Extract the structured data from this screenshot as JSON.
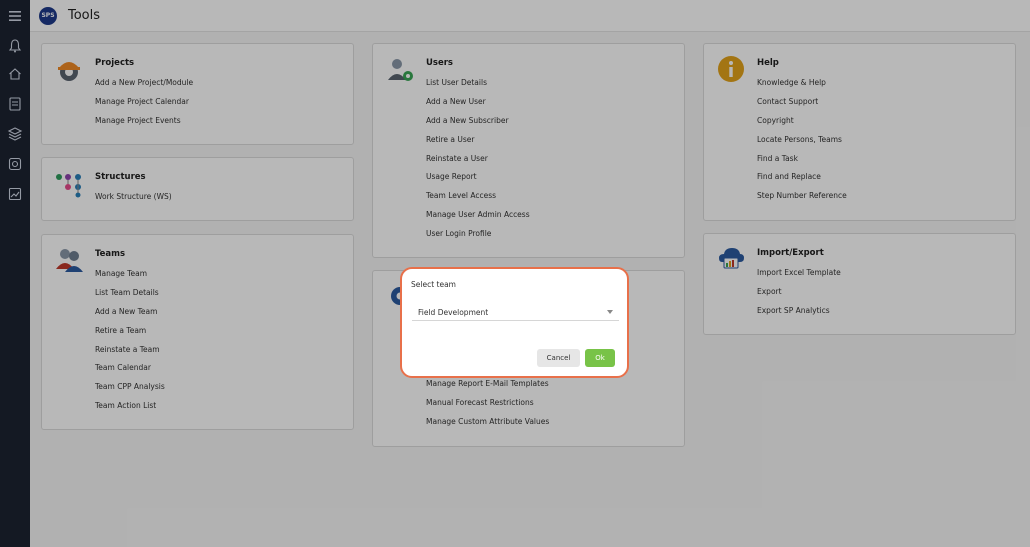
{
  "header": {
    "logo_text": "SPS",
    "title": "Tools"
  },
  "rail": {
    "icons": [
      "menu-icon",
      "bell-icon",
      "home-icon",
      "document-icon",
      "layers-icon",
      "box-icon",
      "chart-icon"
    ]
  },
  "projects": {
    "title": "Projects",
    "items": [
      "Add a New Project/Module",
      "Manage Project Calendar",
      "Manage Project Events"
    ]
  },
  "structures": {
    "title": "Structures",
    "items": [
      "Work Structure (WS)"
    ]
  },
  "teams": {
    "title": "Teams",
    "items": [
      "Manage Team",
      "List Team Details",
      "Add a New Team",
      "Retire a Team",
      "Reinstate a Team",
      "Team Calendar",
      "Team CPP Analysis",
      "Team Action List"
    ]
  },
  "users": {
    "title": "Users",
    "items": [
      "List User Details",
      "Add a New User",
      "Add a New Subscriber",
      "Retire a User",
      "Reinstate a User",
      "Usage Report",
      "Team Level Access",
      "Manage User Admin Access",
      "User Login Profile"
    ]
  },
  "admin": {
    "items": [
      "Manage Report E-Mail Templates",
      "Manual Forecast Restrictions",
      "Manage Custom Attribute Values"
    ]
  },
  "help": {
    "title": "Help",
    "items": [
      "Knowledge & Help",
      "Contact Support",
      "Copyright",
      "Locate Persons, Teams",
      "Find a Task",
      "Find and Replace",
      "Step Number Reference"
    ]
  },
  "importexport": {
    "title": "Import/Export",
    "items": [
      "Import Excel Template",
      "Export",
      "Export SP Analytics"
    ]
  },
  "dialog": {
    "label": "Select team",
    "selected": "Field Development",
    "cancel": "Cancel",
    "ok": "Ok"
  },
  "colors": {
    "accent_border": "#e8704a",
    "ok_green": "#78c348",
    "rail": "#1c2331"
  }
}
